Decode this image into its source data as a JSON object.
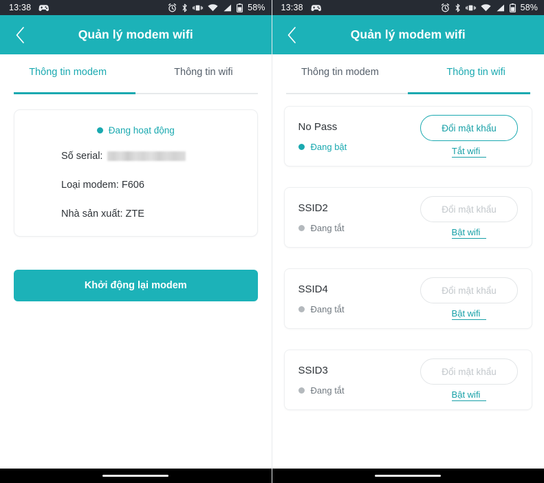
{
  "status_bar": {
    "time": "13:38",
    "battery_percent": "58%",
    "icons": [
      "notification-game-icon",
      "alarm-icon",
      "bluetooth-icon",
      "vibrate-icon",
      "wifi-icon",
      "signal-icon",
      "battery-icon"
    ]
  },
  "app_bar": {
    "title": "Quản lý modem wifi",
    "back_icon": "chevron-left-icon"
  },
  "tabs": [
    {
      "label": "Thông tin modem"
    },
    {
      "label": "Thông tin wifi"
    }
  ],
  "left_panel": {
    "active_tab_index": 0,
    "modem_card": {
      "status_label": "Đang hoạt động",
      "status_dot": "on",
      "rows": [
        {
          "label": "Số serial:",
          "value": "",
          "redacted": true
        },
        {
          "label": "Loại modem: F606",
          "value": "",
          "redacted": false
        },
        {
          "label": "Nhà sản xuất: ZTE",
          "value": "",
          "redacted": false
        }
      ]
    },
    "restart_button_label": "Khởi động lại modem"
  },
  "right_panel": {
    "active_tab_index": 1,
    "wifi_networks": [
      {
        "ssid": "No Pass",
        "state_label": "Đang bật",
        "enabled": true,
        "password_button_label": "Đổi mật khẩu",
        "toggle_link_label": "Tắt wifi"
      },
      {
        "ssid": "SSID2",
        "state_label": "Đang tắt",
        "enabled": false,
        "password_button_label": "Đổi mật khẩu",
        "toggle_link_label": "Bật wifi"
      },
      {
        "ssid": "SSID4",
        "state_label": "Đang tắt",
        "enabled": false,
        "password_button_label": "Đổi mật khẩu",
        "toggle_link_label": "Bật wifi"
      },
      {
        "ssid": "SSID3",
        "state_label": "Đang tắt",
        "enabled": false,
        "password_button_label": "Đổi mật khẩu",
        "toggle_link_label": "Bật wifi"
      }
    ]
  },
  "colors": {
    "accent_teal": "#1cb2b8",
    "accent_teal_text": "#17a0a7",
    "status_bar_bg": "#262b33",
    "nav_bar_bg": "#000000",
    "text_primary": "#2e3338",
    "text_muted": "#727a81",
    "disabled": "#c3c8cc"
  }
}
